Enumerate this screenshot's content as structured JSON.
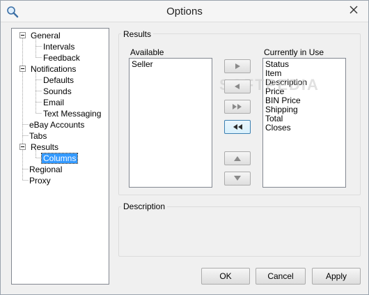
{
  "window": {
    "title": "Options",
    "app_icon": "magnifier-icon",
    "close_icon": "close-icon"
  },
  "tree": [
    {
      "label": "General",
      "expanded": true,
      "children": [
        "Intervals",
        "Feedback"
      ]
    },
    {
      "label": "Notifications",
      "expanded": true,
      "children": [
        "Defaults",
        "Sounds",
        "Email",
        "Text Messaging"
      ]
    },
    {
      "label": "eBay Accounts"
    },
    {
      "label": "Tabs"
    },
    {
      "label": "Results",
      "expanded": true,
      "children": [
        "Columns"
      ],
      "selected_child": "Columns"
    },
    {
      "label": "Regional"
    },
    {
      "label": "Proxy"
    }
  ],
  "results": {
    "group_label": "Results",
    "available_label": "Available",
    "available_items": [
      "Seller"
    ],
    "in_use_label": "Currently in Use",
    "in_use_items": [
      "Status",
      "Item",
      "Description",
      "Price",
      "BIN Price",
      "Shipping",
      "Total",
      "Closes"
    ]
  },
  "move_buttons": {
    "add_one": "▶",
    "remove_one": "◀",
    "add_all": "▶▶",
    "remove_all": "◀◀",
    "move_up": "▲",
    "move_down": "▼"
  },
  "description": {
    "group_label": "Description",
    "text": ""
  },
  "buttons": {
    "ok": "OK",
    "cancel": "Cancel",
    "apply": "Apply"
  },
  "watermark": "SOFTPEDIA",
  "colors": {
    "selection": "#3399ff",
    "border": "#828790",
    "background": "#f0f0f0"
  }
}
